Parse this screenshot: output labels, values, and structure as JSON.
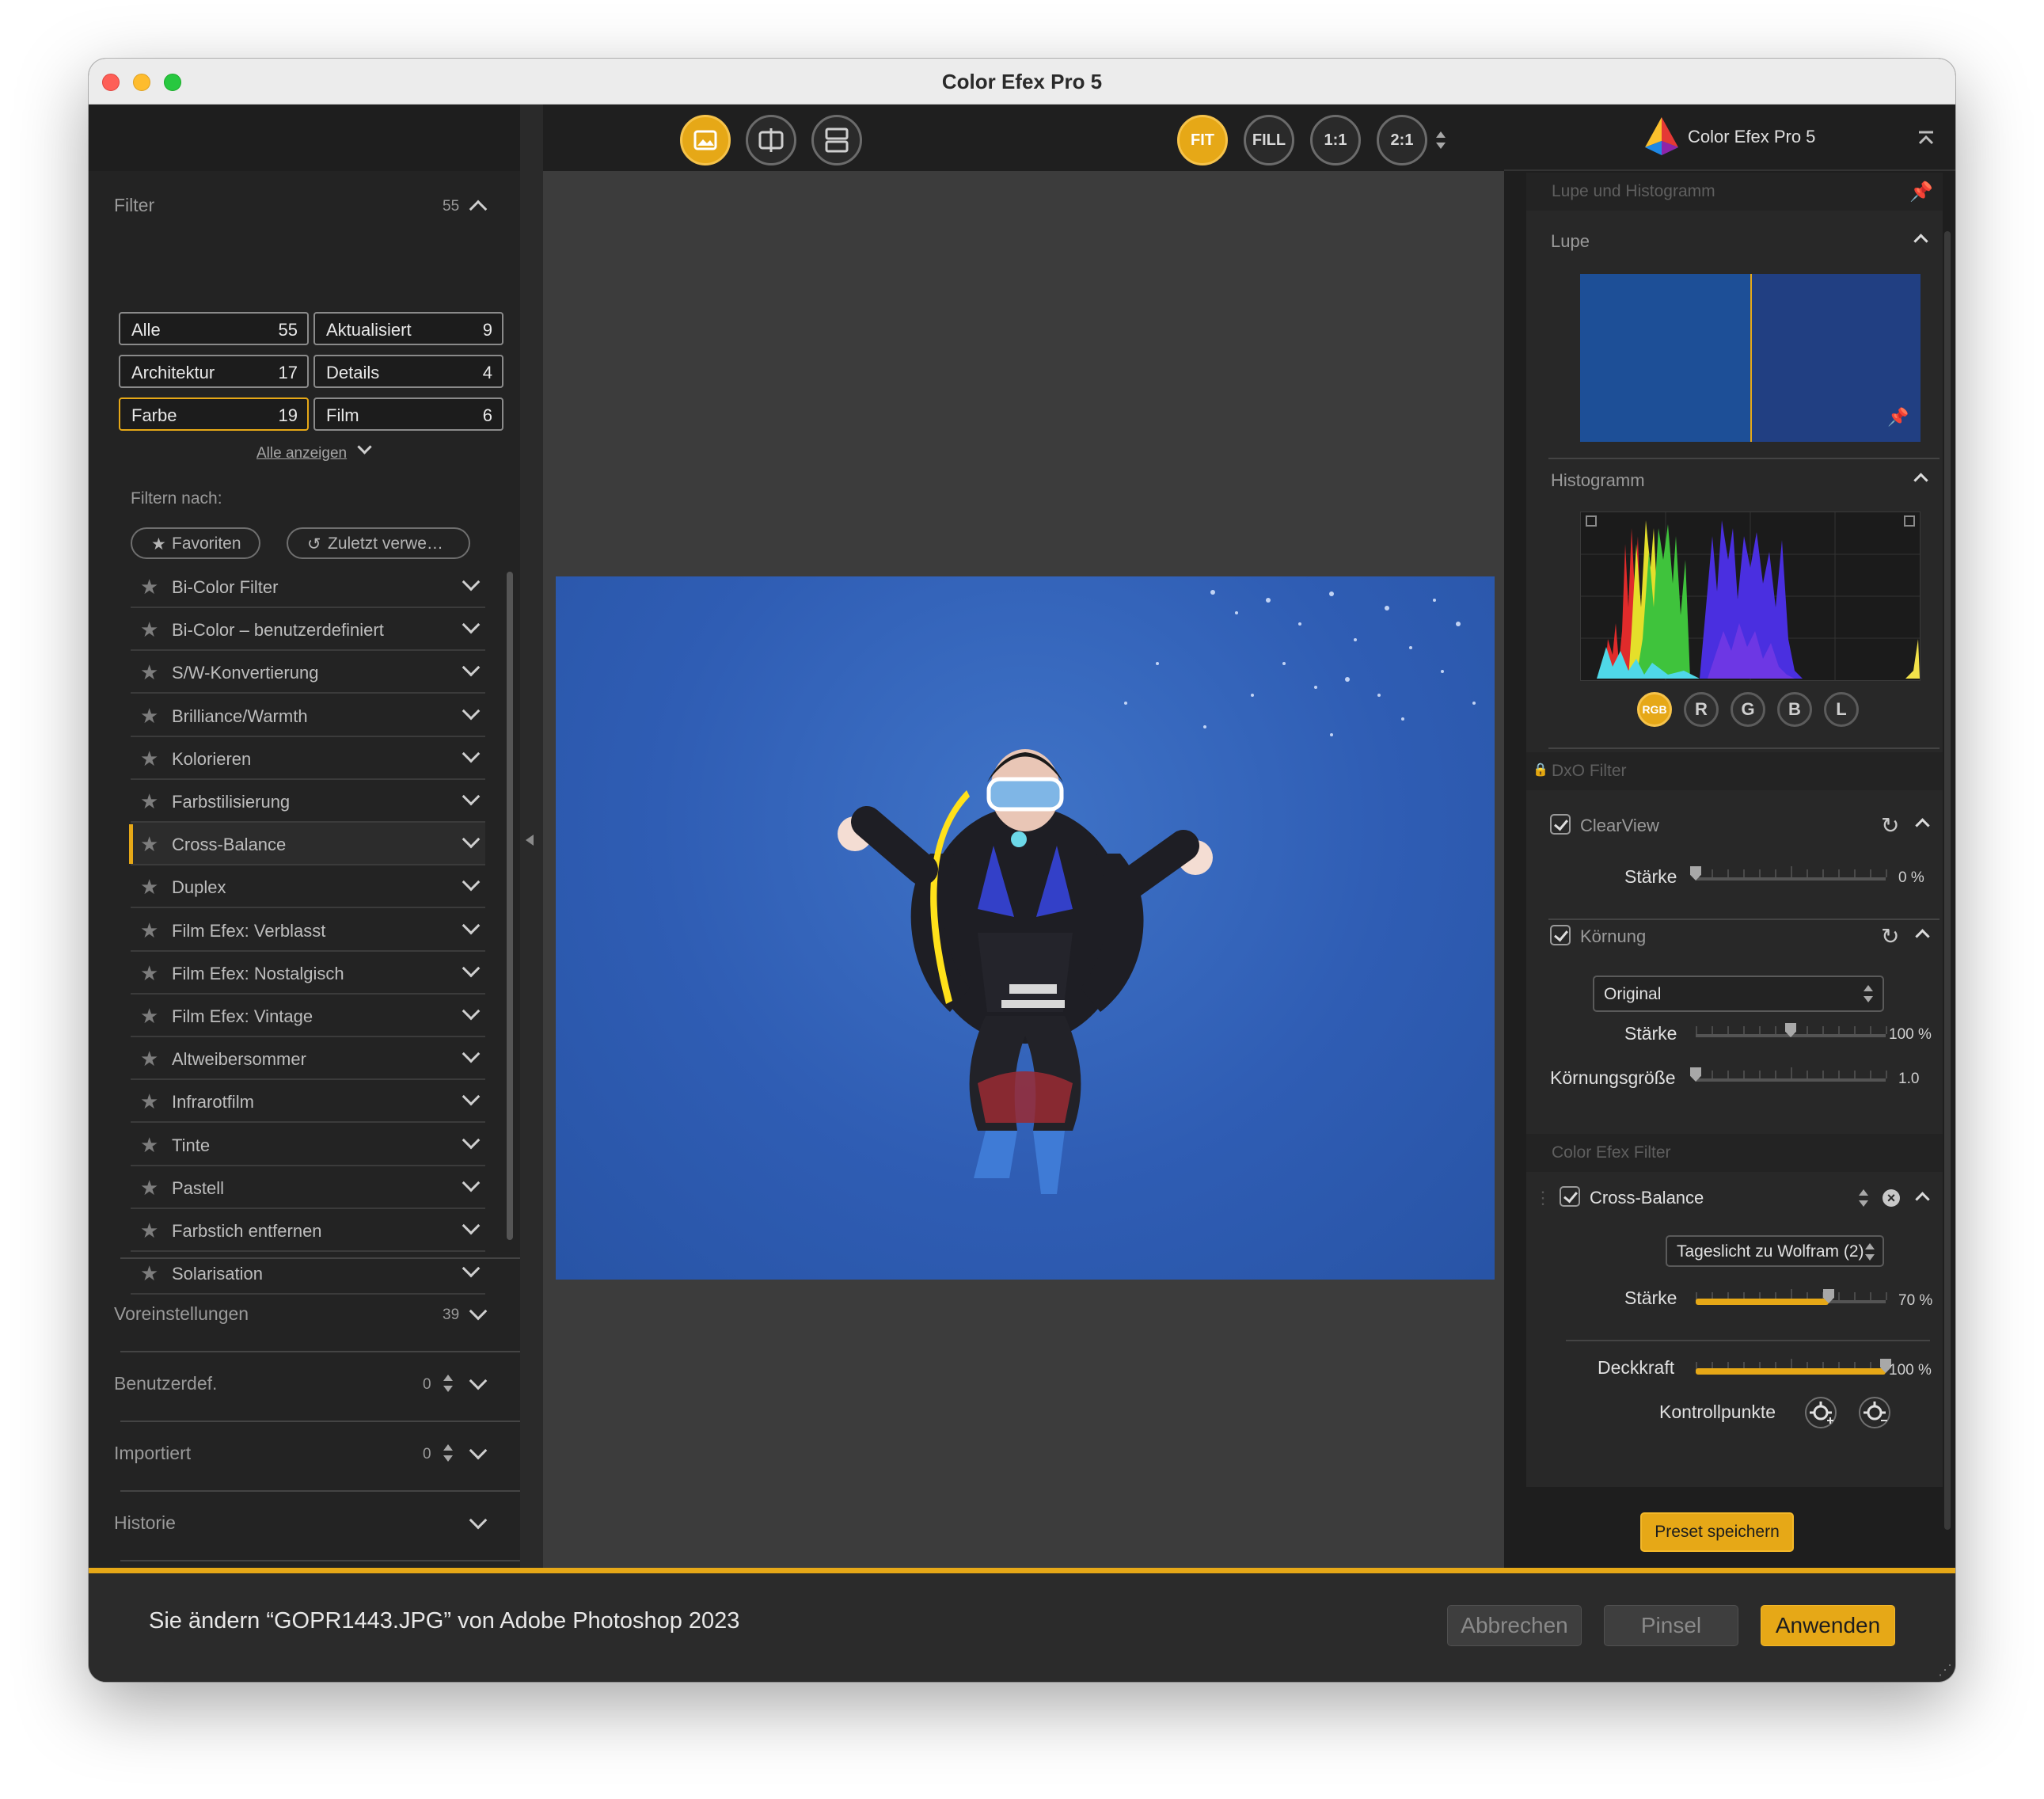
{
  "window": {
    "title": "Color Efex Pro 5"
  },
  "left_panel": {
    "filter_header": "Filter",
    "filter_count": "55",
    "tags": [
      {
        "label": "Alle",
        "count": "55"
      },
      {
        "label": "Aktualisiert",
        "count": "9"
      },
      {
        "label": "Architektur",
        "count": "17"
      },
      {
        "label": "Details",
        "count": "4"
      },
      {
        "label": "Farbe",
        "count": "19",
        "selected": true
      },
      {
        "label": "Film",
        "count": "6"
      }
    ],
    "show_all": "Alle anzeigen",
    "filter_by": "Filtern nach:",
    "favorites": "Favoriten",
    "recent": "Zuletzt verwe…",
    "filters": [
      "Bi-Color Filter",
      "Bi-Color – benutzerdefiniert",
      "S/W-Konvertierung",
      "Brilliance/Warmth",
      "Kolorieren",
      "Farbstilisierung",
      "Cross-Balance",
      "Duplex",
      "Film Efex: Verblasst",
      "Film Efex: Nostalgisch",
      "Film Efex: Vintage",
      "Altweibersommer",
      "Infrarotfilm",
      "Tinte",
      "Pastell",
      "Farbstich entfernen",
      "Solarisation"
    ],
    "active_filter_index": 6,
    "sections": [
      {
        "label": "Voreinstellungen",
        "count": "39"
      },
      {
        "label": "Benutzerdef.",
        "count": "0"
      },
      {
        "label": "Importiert",
        "count": "0"
      },
      {
        "label": "Historie",
        "count": ""
      }
    ]
  },
  "toolbar": {
    "view_icons": [
      "single-view-icon",
      "split-view-icon",
      "side-by-side-icon"
    ],
    "zoom": [
      "FIT",
      "FILL",
      "1:1",
      "2:1"
    ],
    "active_zoom": "FIT"
  },
  "right_panel": {
    "brand": "Color Efex Pro 5",
    "loupe_histogram": "Lupe und Histogramm",
    "loupe": "Lupe",
    "histogram": "Histogramm",
    "channels": [
      "RGB",
      "R",
      "G",
      "B",
      "L"
    ],
    "dxo_filter": "DxO Filter",
    "clearview": {
      "label": "ClearView",
      "strength_label": "Stärke",
      "strength_value": "0 %",
      "strength": 0
    },
    "grain": {
      "label": "Körnung",
      "type": "Original",
      "strength_label": "Stärke",
      "strength_value": "100 %",
      "strength": 0.5,
      "size_label": "Körnungsgröße",
      "size_value": "1.0",
      "size": 0
    },
    "color_efex_filter": "Color Efex Filter",
    "cross_balance": {
      "label": "Cross-Balance",
      "mode": "Tageslicht zu Wolfram (2)",
      "strength_label": "Stärke",
      "strength_value": "70 %",
      "strength": 0.7
    },
    "opacity_label": "Deckkraft",
    "opacity_value": "100 %",
    "opacity": 1.0,
    "control_points": "Kontrollpunkte",
    "save_preset": "Preset speichern"
  },
  "bottom": {
    "status": "Sie ändern “GOPR1443.JPG” von Adobe Photoshop 2023",
    "cancel": "Abbrechen",
    "brush": "Pinsel",
    "apply": "Anwenden"
  },
  "colors": {
    "accent": "#e6a817",
    "panel": "#232323",
    "canvas": "#3c3c3c"
  }
}
